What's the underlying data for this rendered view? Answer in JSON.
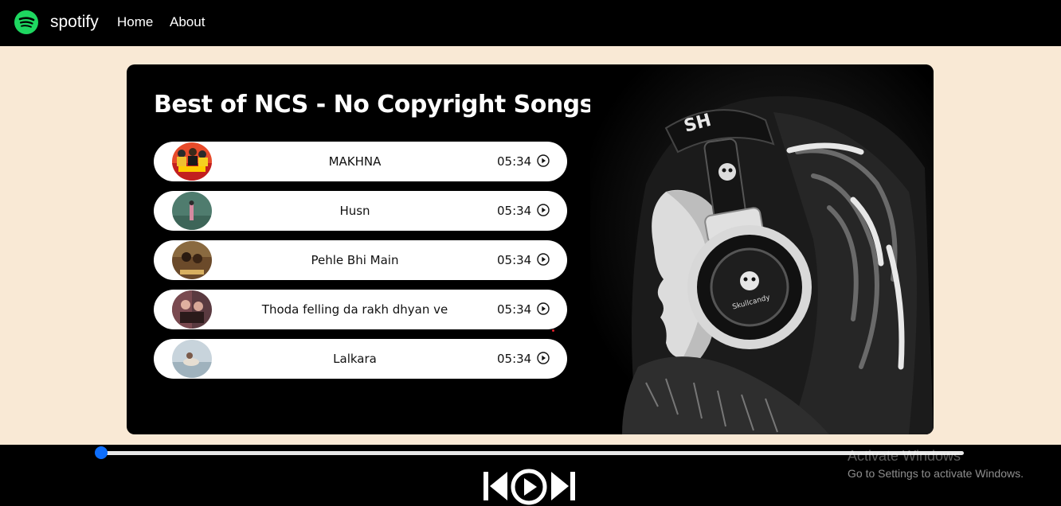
{
  "nav": {
    "brand": "spotify",
    "links": [
      "Home",
      "About"
    ],
    "logo_icon": "spotify-logo-icon",
    "logo_color": "#1ed760"
  },
  "playlist": {
    "title": "Best of NCS - No Copyright Songs",
    "songs": [
      {
        "name": "MAKHNA",
        "duration": "05:34"
      },
      {
        "name": "Husn",
        "duration": "05:34"
      },
      {
        "name": "Pehle Bhi Main",
        "duration": "05:34"
      },
      {
        "name": "Thoda felling da rakh dhyan ve",
        "duration": "05:34"
      },
      {
        "name": "Lalkara",
        "duration": "05:34"
      }
    ],
    "play_icon": "play-circle-icon"
  },
  "player": {
    "progress": 0,
    "accent_color": "#0d6efd",
    "controls": [
      "previous-icon",
      "play-icon",
      "next-icon"
    ]
  },
  "watermark": {
    "line1": "Activate Windows",
    "line2": "Go to Settings to activate Windows."
  },
  "colors": {
    "page_bg": "#f9e9d5",
    "nav_bg": "#000000",
    "card_bg": "#000000"
  }
}
